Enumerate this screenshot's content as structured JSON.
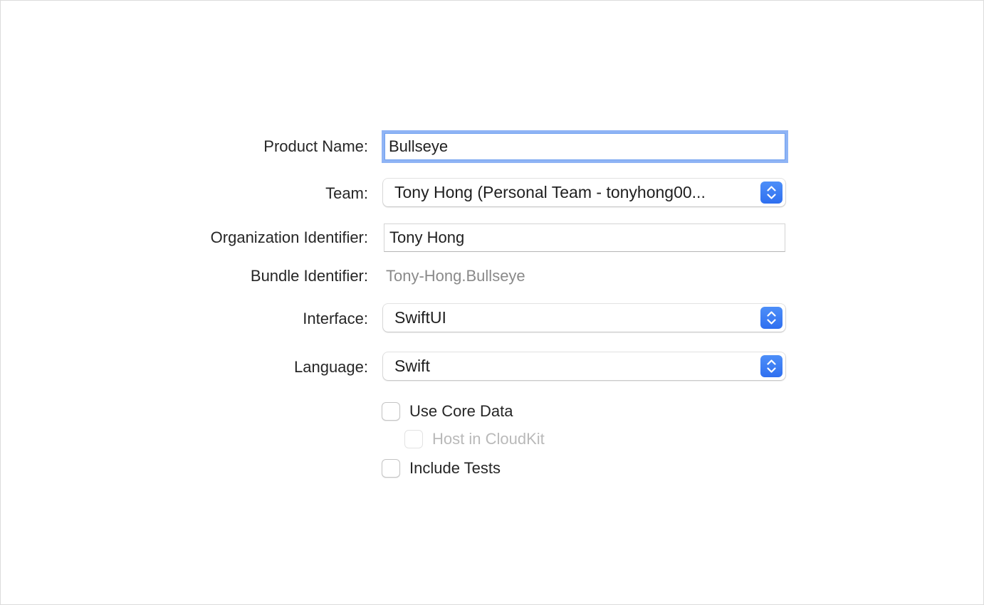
{
  "form": {
    "product_name": {
      "label": "Product Name:",
      "value": "Bullseye"
    },
    "team": {
      "label": "Team:",
      "selected": "Tony Hong (Personal Team - tonyhong00..."
    },
    "organization_identifier": {
      "label": "Organization Identifier:",
      "value": "Tony Hong"
    },
    "bundle_identifier": {
      "label": "Bundle Identifier:",
      "value": "Tony-Hong.Bullseye"
    },
    "interface": {
      "label": "Interface:",
      "selected": "SwiftUI"
    },
    "language": {
      "label": "Language:",
      "selected": "Swift"
    },
    "use_core_data": {
      "label": "Use Core Data",
      "checked": false
    },
    "host_in_cloudkit": {
      "label": "Host in CloudKit",
      "checked": false,
      "enabled": false
    },
    "include_tests": {
      "label": "Include Tests",
      "checked": false
    }
  },
  "colors": {
    "accent": "#3478f6",
    "focus_ring": "#8fb4f5",
    "secondary_text": "#8a8a8a",
    "disabled_text": "#b9b9b9"
  },
  "icons": {
    "popup_indicator": "chevron-up-down-icon"
  }
}
